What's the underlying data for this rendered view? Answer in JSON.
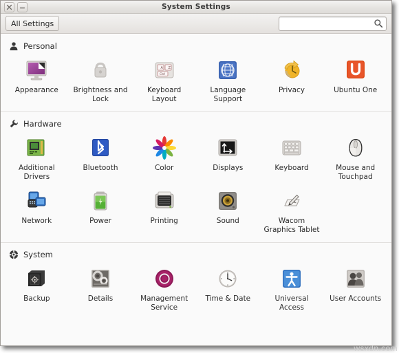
{
  "window": {
    "title": "System Settings",
    "buttons": [
      {
        "name": "close",
        "glyph": "×"
      },
      {
        "name": "minimize",
        "glyph": "−"
      }
    ]
  },
  "toolbar": {
    "all_settings_label": "All Settings",
    "search": {
      "value": "",
      "placeholder": "",
      "icon": "search-icon"
    }
  },
  "sections": [
    {
      "id": "personal",
      "label": "Personal",
      "icon": "person-icon",
      "items": [
        {
          "id": "appearance",
          "label": "Appearance",
          "icon": "appearance-icon"
        },
        {
          "id": "brightness-and-lock",
          "label": "Brightness and Lock",
          "icon": "brightness-lock-icon"
        },
        {
          "id": "keyboard-layout",
          "label": "Keyboard Layout",
          "icon": "keyboard-layout-icon"
        },
        {
          "id": "language-support",
          "label": "Language Support",
          "icon": "language-support-icon"
        },
        {
          "id": "privacy",
          "label": "Privacy",
          "icon": "privacy-icon"
        },
        {
          "id": "ubuntu-one",
          "label": "Ubuntu One",
          "icon": "ubuntu-one-icon"
        }
      ]
    },
    {
      "id": "hardware",
      "label": "Hardware",
      "icon": "wrench-icon",
      "items": [
        {
          "id": "additional-drivers",
          "label": "Additional Drivers",
          "icon": "additional-drivers-icon"
        },
        {
          "id": "bluetooth",
          "label": "Bluetooth",
          "icon": "bluetooth-icon"
        },
        {
          "id": "color",
          "label": "Color",
          "icon": "color-icon"
        },
        {
          "id": "displays",
          "label": "Displays",
          "icon": "displays-icon"
        },
        {
          "id": "keyboard",
          "label": "Keyboard",
          "icon": "keyboard-icon"
        },
        {
          "id": "mouse-and-touchpad",
          "label": "Mouse and Touchpad",
          "icon": "mouse-touchpad-icon"
        },
        {
          "id": "network",
          "label": "Network",
          "icon": "network-icon"
        },
        {
          "id": "power",
          "label": "Power",
          "icon": "power-battery-icon"
        },
        {
          "id": "printing",
          "label": "Printing",
          "icon": "printer-icon"
        },
        {
          "id": "sound",
          "label": "Sound",
          "icon": "speaker-icon"
        },
        {
          "id": "wacom-graphics-tablet",
          "label": "Wacom Graphics Tablet",
          "icon": "wacom-tablet-icon"
        }
      ]
    },
    {
      "id": "system",
      "label": "System",
      "icon": "system-gear-icon",
      "items": [
        {
          "id": "backup",
          "label": "Backup",
          "icon": "safe-icon"
        },
        {
          "id": "details",
          "label": "Details",
          "icon": "details-icon"
        },
        {
          "id": "management-service",
          "label": "Management Service",
          "icon": "management-service-icon"
        },
        {
          "id": "time-and-date",
          "label": "Time & Date",
          "icon": "clock-icon"
        },
        {
          "id": "universal-access",
          "label": "Universal Access",
          "icon": "accessibility-icon"
        },
        {
          "id": "user-accounts",
          "label": "User Accounts",
          "icon": "users-icon"
        }
      ]
    }
  ],
  "watermark": "wsxdn.com",
  "colors": {
    "window_bg": "#f2f1f0",
    "content_bg": "#fafafa",
    "accent_ubuntu_orange": "#dd4814",
    "accent_bluetooth_blue": "#2a56c6",
    "accent_management_magenta": "#a01f63",
    "text": "#2b2b2b"
  }
}
